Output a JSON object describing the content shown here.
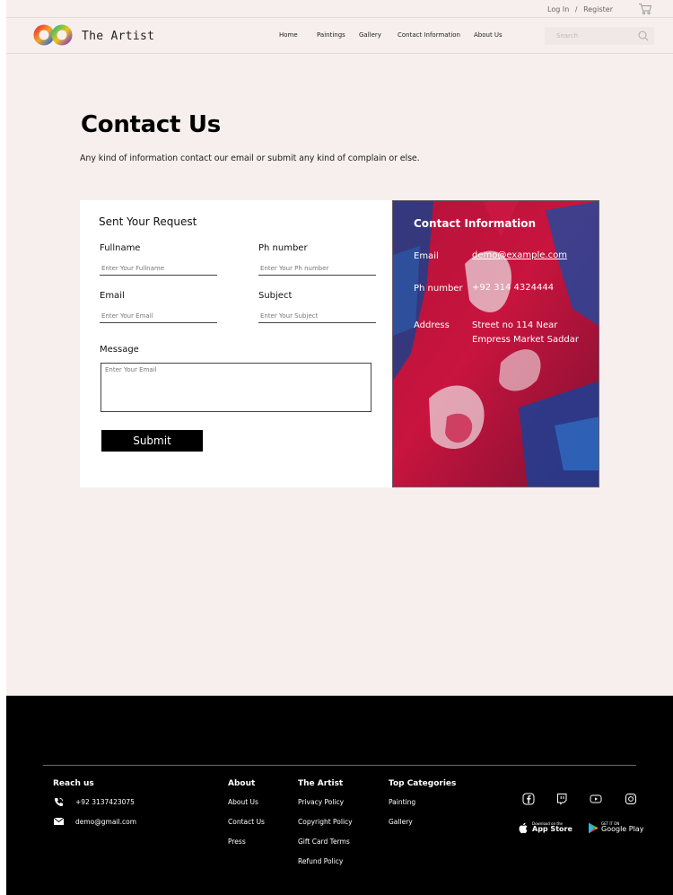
{
  "header": {
    "brand": "The Artist",
    "login": "Log In",
    "separator": "/",
    "register": "Register",
    "nav": [
      "Home",
      "Paintings",
      "Gallery",
      "Contact Information",
      "About Us"
    ],
    "search_placeholder": "Search"
  },
  "main": {
    "title": "Contact Us",
    "subtitle": "Any kind of information contact our email or submit any kind of complain or else."
  },
  "form": {
    "title": "Sent Your Request",
    "fullname_label": "Fullname",
    "fullname_placeholder": "Enter Your Fullname",
    "phone_label": "Ph number",
    "phone_placeholder": "Enter Your Ph number",
    "email_label": "Email",
    "email_placeholder": "Enter Your Email",
    "subject_label": "Subject",
    "subject_placeholder": "Enter Your Subject",
    "message_label": "Message",
    "message_placeholder": "Enter Your Email",
    "submit_label": "Submit"
  },
  "contact_info": {
    "title": "Contact Information",
    "email_label": "Email",
    "email_value": "demo@example.com",
    "phone_label": "Ph number",
    "phone_value": "+92 314 4324444",
    "address_label": "Address",
    "address_line1": "Street no 114 Near",
    "address_line2": "Empress Market Saddar"
  },
  "footer": {
    "reach_title": "Reach us",
    "phone": "+92 3137423075",
    "email": "demo@gmail.com",
    "about_title": "About",
    "about_links": [
      "About Us",
      "Contact Us",
      "Press"
    ],
    "artist_title": "The Artist",
    "artist_links": [
      "Privacy Policy",
      "Copyright Policy",
      "Gift Card Terms",
      "Refund Policy"
    ],
    "categories_title": "Top Categories",
    "categories_links": [
      "Painting",
      "Gallery"
    ],
    "app_store_small": "Download on the",
    "app_store_big": "App Store",
    "google_play_small": "GET IT ON",
    "google_play_big": "Google Play"
  },
  "icons": {
    "cart": "cart-icon",
    "search": "search-icon",
    "phone": "phone-icon",
    "mail": "mail-icon",
    "social": [
      "facebook-icon",
      "twitch-icon",
      "youtube-icon",
      "instagram-icon"
    ],
    "apple": "apple-icon",
    "play": "google-play-icon"
  },
  "colors": {
    "page_background": "#f6efed",
    "footer_background": "#000000",
    "button_background": "#000000"
  }
}
